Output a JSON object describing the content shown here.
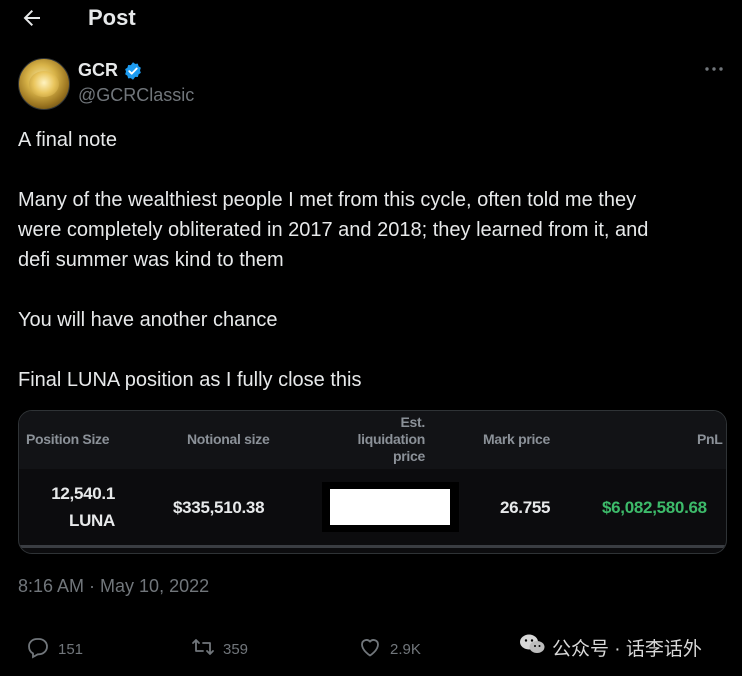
{
  "header": {
    "title": "Post"
  },
  "author": {
    "name": "GCR",
    "handle": "@GCRClassic"
  },
  "tweet": {
    "lines": [
      "A final note",
      "Many of the wealthiest people I met from this cycle, often told me they",
      "were completely obliterated in 2017 and 2018;  they learned from it, and",
      "defi summer was kind to them",
      "You will have another chance",
      "Final LUNA position as I fully close this"
    ]
  },
  "position_card": {
    "headers": {
      "position_size": "Position Size",
      "notional_size": "Notional size",
      "liq_line1": "Est.",
      "liq_line2": "liquidation",
      "liq_line3": "price",
      "mark_price": "Mark price",
      "pnl": "PnL"
    },
    "row": {
      "position_size_amount": "12,540.1",
      "position_size_unit": "LUNA",
      "notional_size": "$335,510.38",
      "mark_price": "26.755",
      "pnl": "$6,082,580.68"
    },
    "colors": {
      "pnl": "#3dbb6a"
    }
  },
  "timestamp": "8:16 AM · May 10, 2022",
  "actions": {
    "replies": "151",
    "reposts": "359",
    "likes": "2.9K"
  },
  "watermark": "公众号 · 话李话外"
}
